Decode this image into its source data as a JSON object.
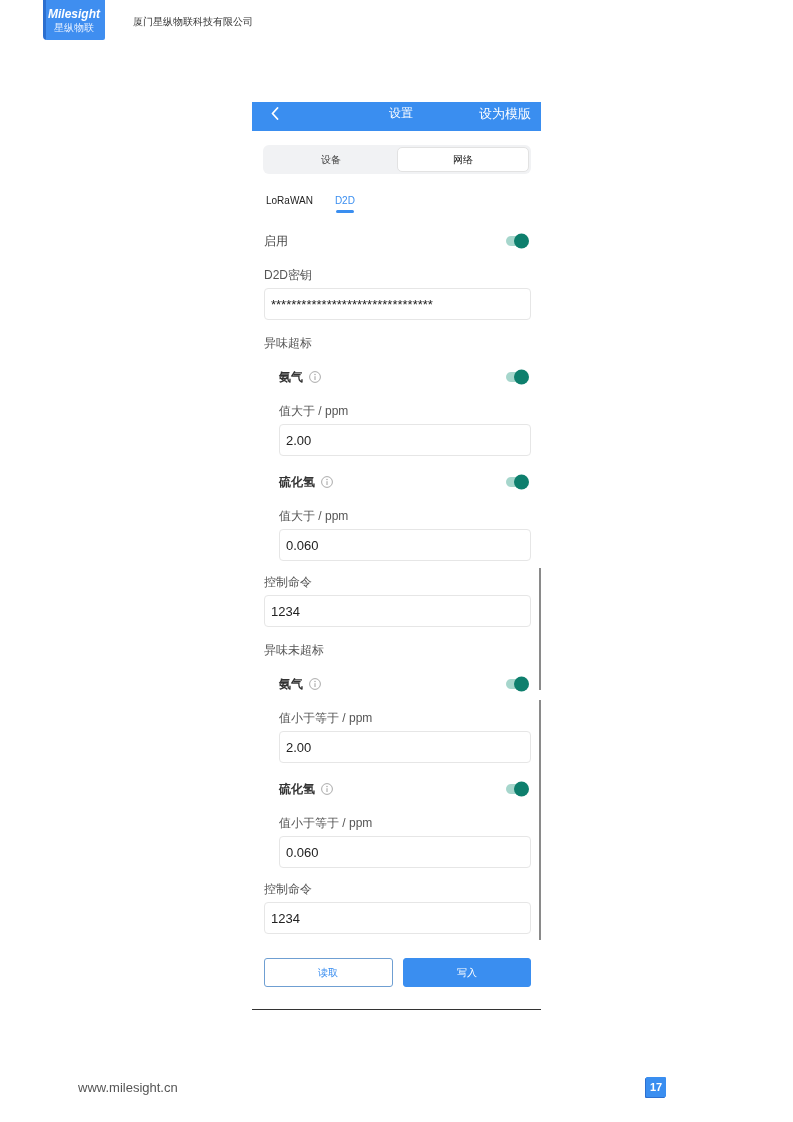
{
  "header": {
    "brand": "Milesight",
    "brand_sub": "星纵物联",
    "company": "厦门星纵物联科技有限公司"
  },
  "app": {
    "top_bar": {
      "title": "设置",
      "action": "设为模版"
    },
    "segments": [
      {
        "label": "设备",
        "selected": false
      },
      {
        "label": "网络",
        "selected": true
      }
    ],
    "tabs": [
      {
        "label": "LoRaWAN",
        "selected": false
      },
      {
        "label": "D2D",
        "selected": true
      }
    ],
    "form": [
      {
        "kind": "toggle",
        "label": "启用",
        "on": true
      },
      {
        "kind": "field",
        "label": "D2D密钥",
        "value": "********************************"
      },
      {
        "kind": "group",
        "label": "异味超标",
        "children": [
          {
            "kind": "sensor",
            "label": "氨气",
            "on": true
          },
          {
            "kind": "field",
            "label": "值大于 / ppm",
            "value": "2.00"
          },
          {
            "kind": "sensor",
            "label": "硫化氢",
            "on": true
          },
          {
            "kind": "field",
            "label": "值大于 / ppm",
            "value": "0.060"
          }
        ]
      },
      {
        "kind": "field",
        "label": "控制命令",
        "value": "1234"
      },
      {
        "kind": "group",
        "label": "异味未超标",
        "children": [
          {
            "kind": "sensor",
            "label": "氨气",
            "on": true
          },
          {
            "kind": "field",
            "label": "值小于等于 / ppm",
            "value": "2.00"
          },
          {
            "kind": "sensor",
            "label": "硫化氢",
            "on": true
          },
          {
            "kind": "field",
            "label": "值小于等于 / ppm",
            "value": "0.060"
          }
        ]
      },
      {
        "kind": "field",
        "label": "控制命令",
        "value": "1234"
      }
    ],
    "buttons": [
      {
        "label": "读取",
        "kind": "secondary"
      },
      {
        "label": "写入",
        "kind": "primary"
      }
    ]
  },
  "footer": {
    "url": "www.milesight.cn",
    "page": "17"
  }
}
